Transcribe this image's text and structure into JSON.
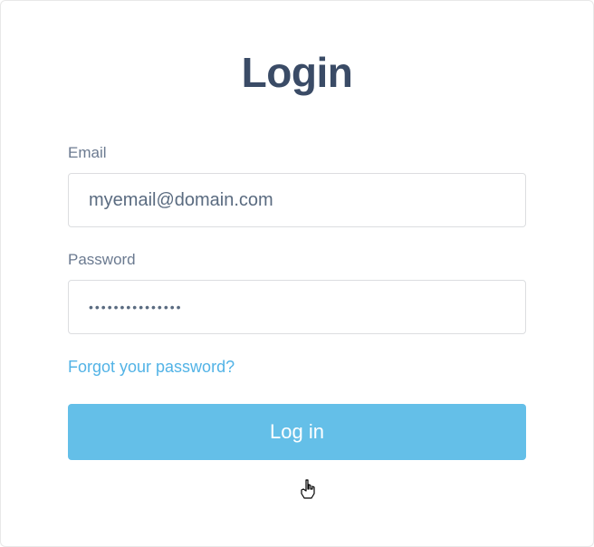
{
  "title": "Login",
  "email": {
    "label": "Email",
    "value": "myemail@domain.com"
  },
  "password": {
    "label": "Password",
    "value": "•••••••••••••••"
  },
  "forgot_link": "Forgot your password?",
  "login_button": "Log in"
}
